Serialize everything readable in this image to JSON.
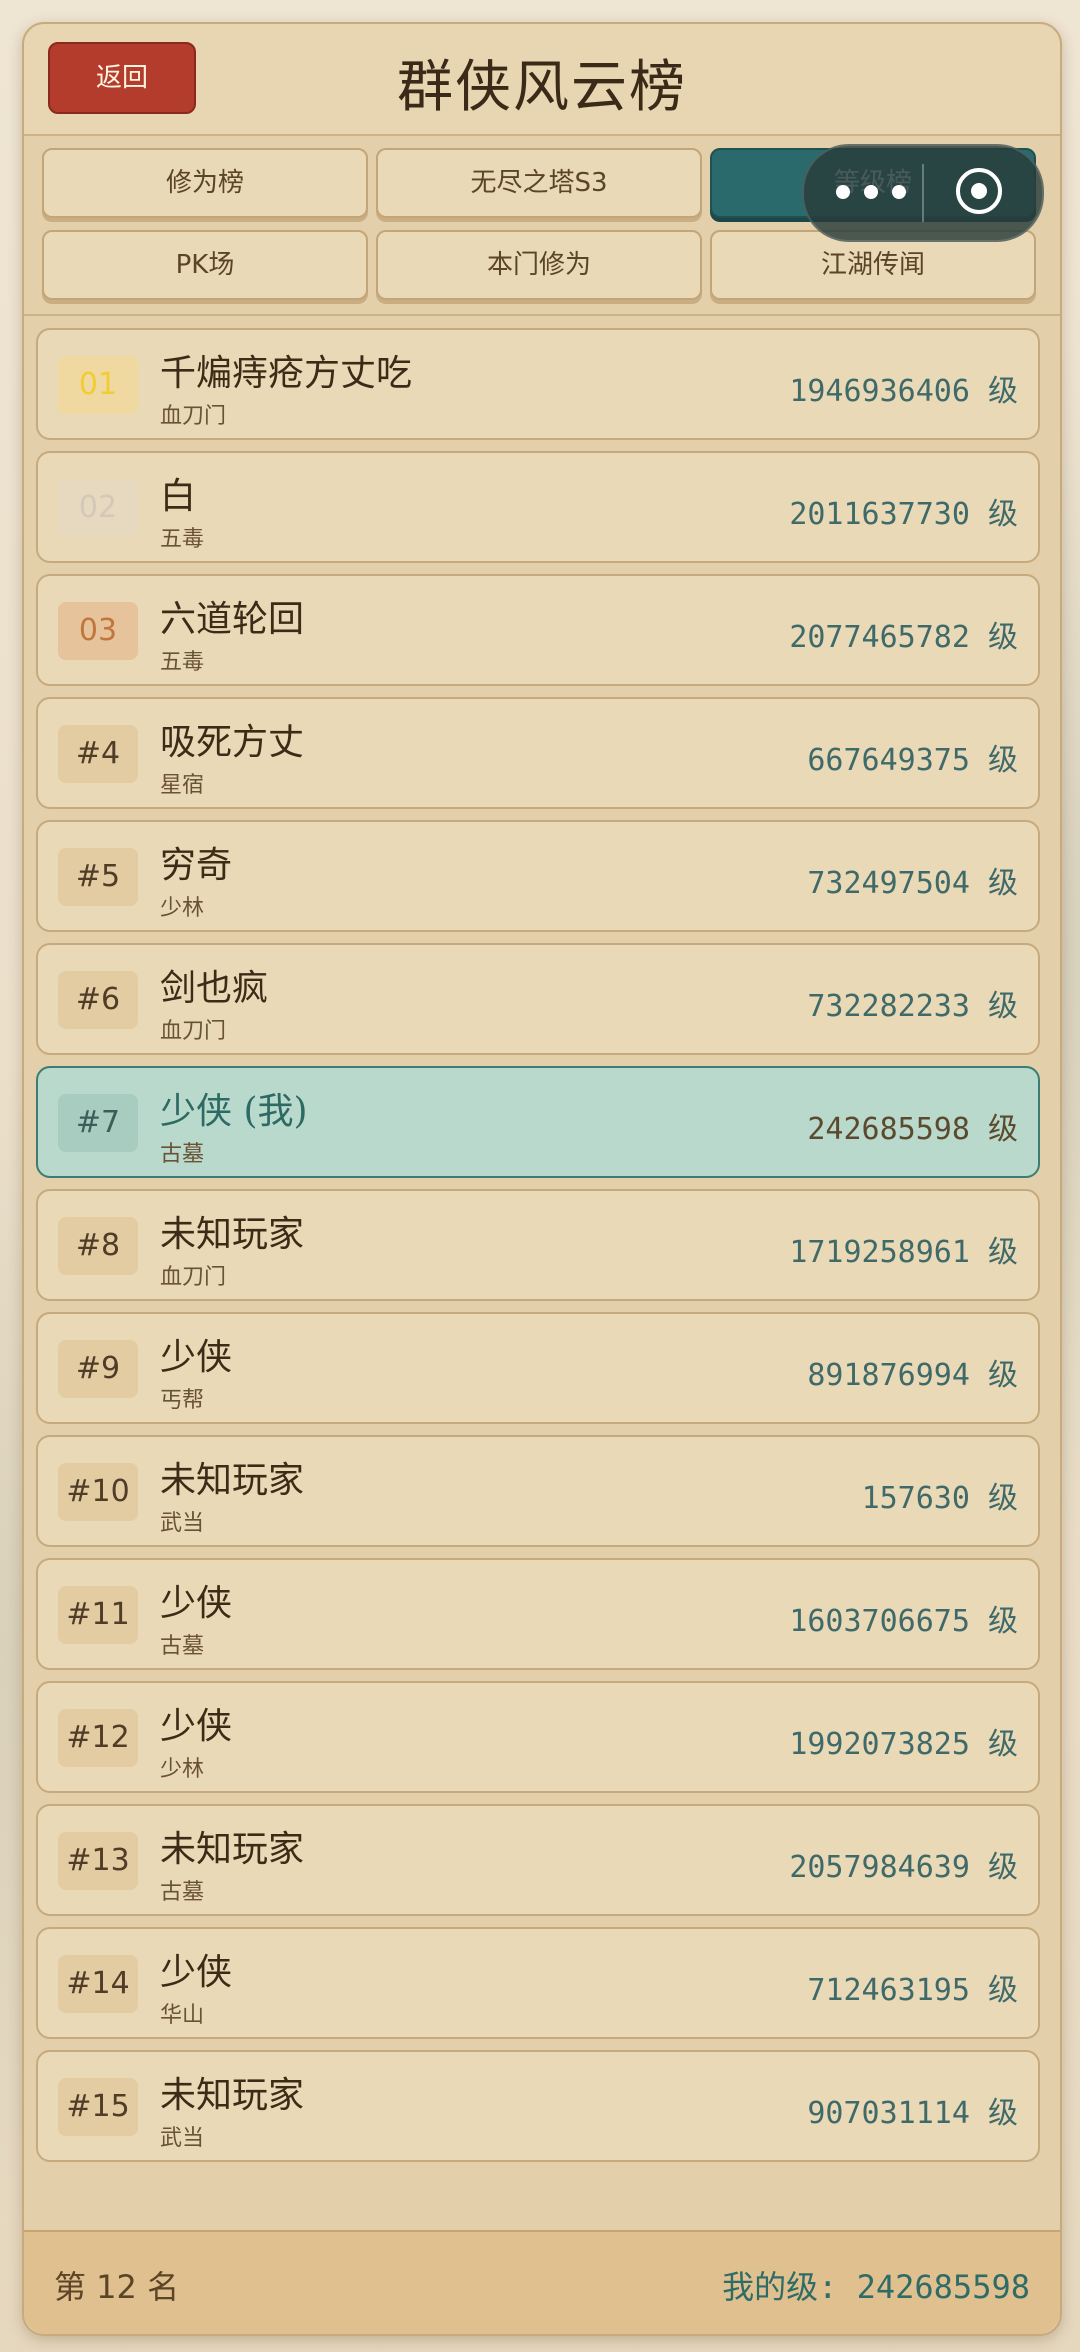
{
  "header": {
    "back_label": "返回",
    "title": "群侠风云榜"
  },
  "tabs": [
    {
      "label": "修为榜"
    },
    {
      "label": "无尽之塔S3"
    },
    {
      "label": "等级榜"
    },
    {
      "label": "PK场"
    },
    {
      "label": "本门修为"
    },
    {
      "label": "江湖传闻"
    }
  ],
  "active_tab": "等级榜",
  "leaderboard": [
    {
      "rank": "01",
      "name": "千煸痔疮方丈吃",
      "sect": "血刀门",
      "level": "1946936406 级"
    },
    {
      "rank": "02",
      "name": "白",
      "sect": "五毒",
      "level": "2011637730 级"
    },
    {
      "rank": "03",
      "name": "六道轮回",
      "sect": "五毒",
      "level": "2077465782 级"
    },
    {
      "rank": "#4",
      "name": "吸死方丈",
      "sect": "星宿",
      "level": "667649375 级"
    },
    {
      "rank": "#5",
      "name": "穷奇",
      "sect": "少林",
      "level": "732497504 级"
    },
    {
      "rank": "#6",
      "name": "剑也疯",
      "sect": "血刀门",
      "level": "732282233 级"
    },
    {
      "rank": "#7",
      "name": "少侠 (我)",
      "sect": "古墓",
      "level": "242685598 级"
    },
    {
      "rank": "#8",
      "name": "未知玩家",
      "sect": "血刀门",
      "level": "1719258961 级"
    },
    {
      "rank": "#9",
      "name": "少侠",
      "sect": "丐帮",
      "level": "891876994 级"
    },
    {
      "rank": "#10",
      "name": "未知玩家",
      "sect": "武当",
      "level": "157630 级"
    },
    {
      "rank": "#11",
      "name": "少侠",
      "sect": "古墓",
      "level": "1603706675 级"
    },
    {
      "rank": "#12",
      "name": "少侠",
      "sect": "少林",
      "level": "1992073825 级"
    },
    {
      "rank": "#13",
      "name": "未知玩家",
      "sect": "古墓",
      "level": "2057984639 级"
    },
    {
      "rank": "#14",
      "name": "少侠",
      "sect": "华山",
      "level": "712463195 级"
    },
    {
      "rank": "#15",
      "name": "未知玩家",
      "sect": "武当",
      "level": "907031114 级"
    }
  ],
  "footer": {
    "my_rank": "第 12 名",
    "my_level": "我的级: 242685598"
  },
  "colors": {
    "accent": "#2a6a6c",
    "back_button": "#b43c2c",
    "panel": "#e3cfa9",
    "highlight_row": "#b9d9cc"
  },
  "icons": {
    "capsule_menu": "more-dots-icon",
    "capsule_close": "target-close-icon"
  }
}
